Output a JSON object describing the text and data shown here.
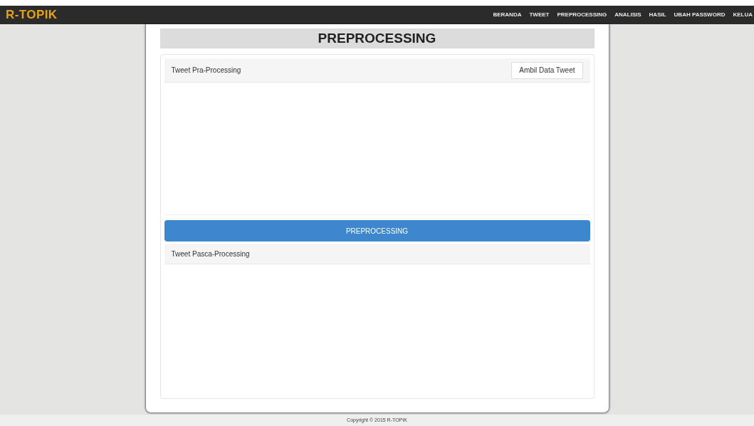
{
  "navbar": {
    "brand": "R-TOPIK",
    "items": [
      "BERANDA",
      "TWEET",
      "PREPROCESSING",
      "ANALISIS",
      "HASIL",
      "UBAH PASSWORD",
      "KELUA"
    ]
  },
  "page_title": "PREPROCESSING",
  "input_panel": {
    "title": "Tweet Pra-Processing",
    "button": "Ambil Data Tweet"
  },
  "process_button": "PREPROCESSING",
  "output_panel": {
    "title": "Tweet Pasca-Processing"
  },
  "footer": "Copyright © 2015 R-TOPIK"
}
